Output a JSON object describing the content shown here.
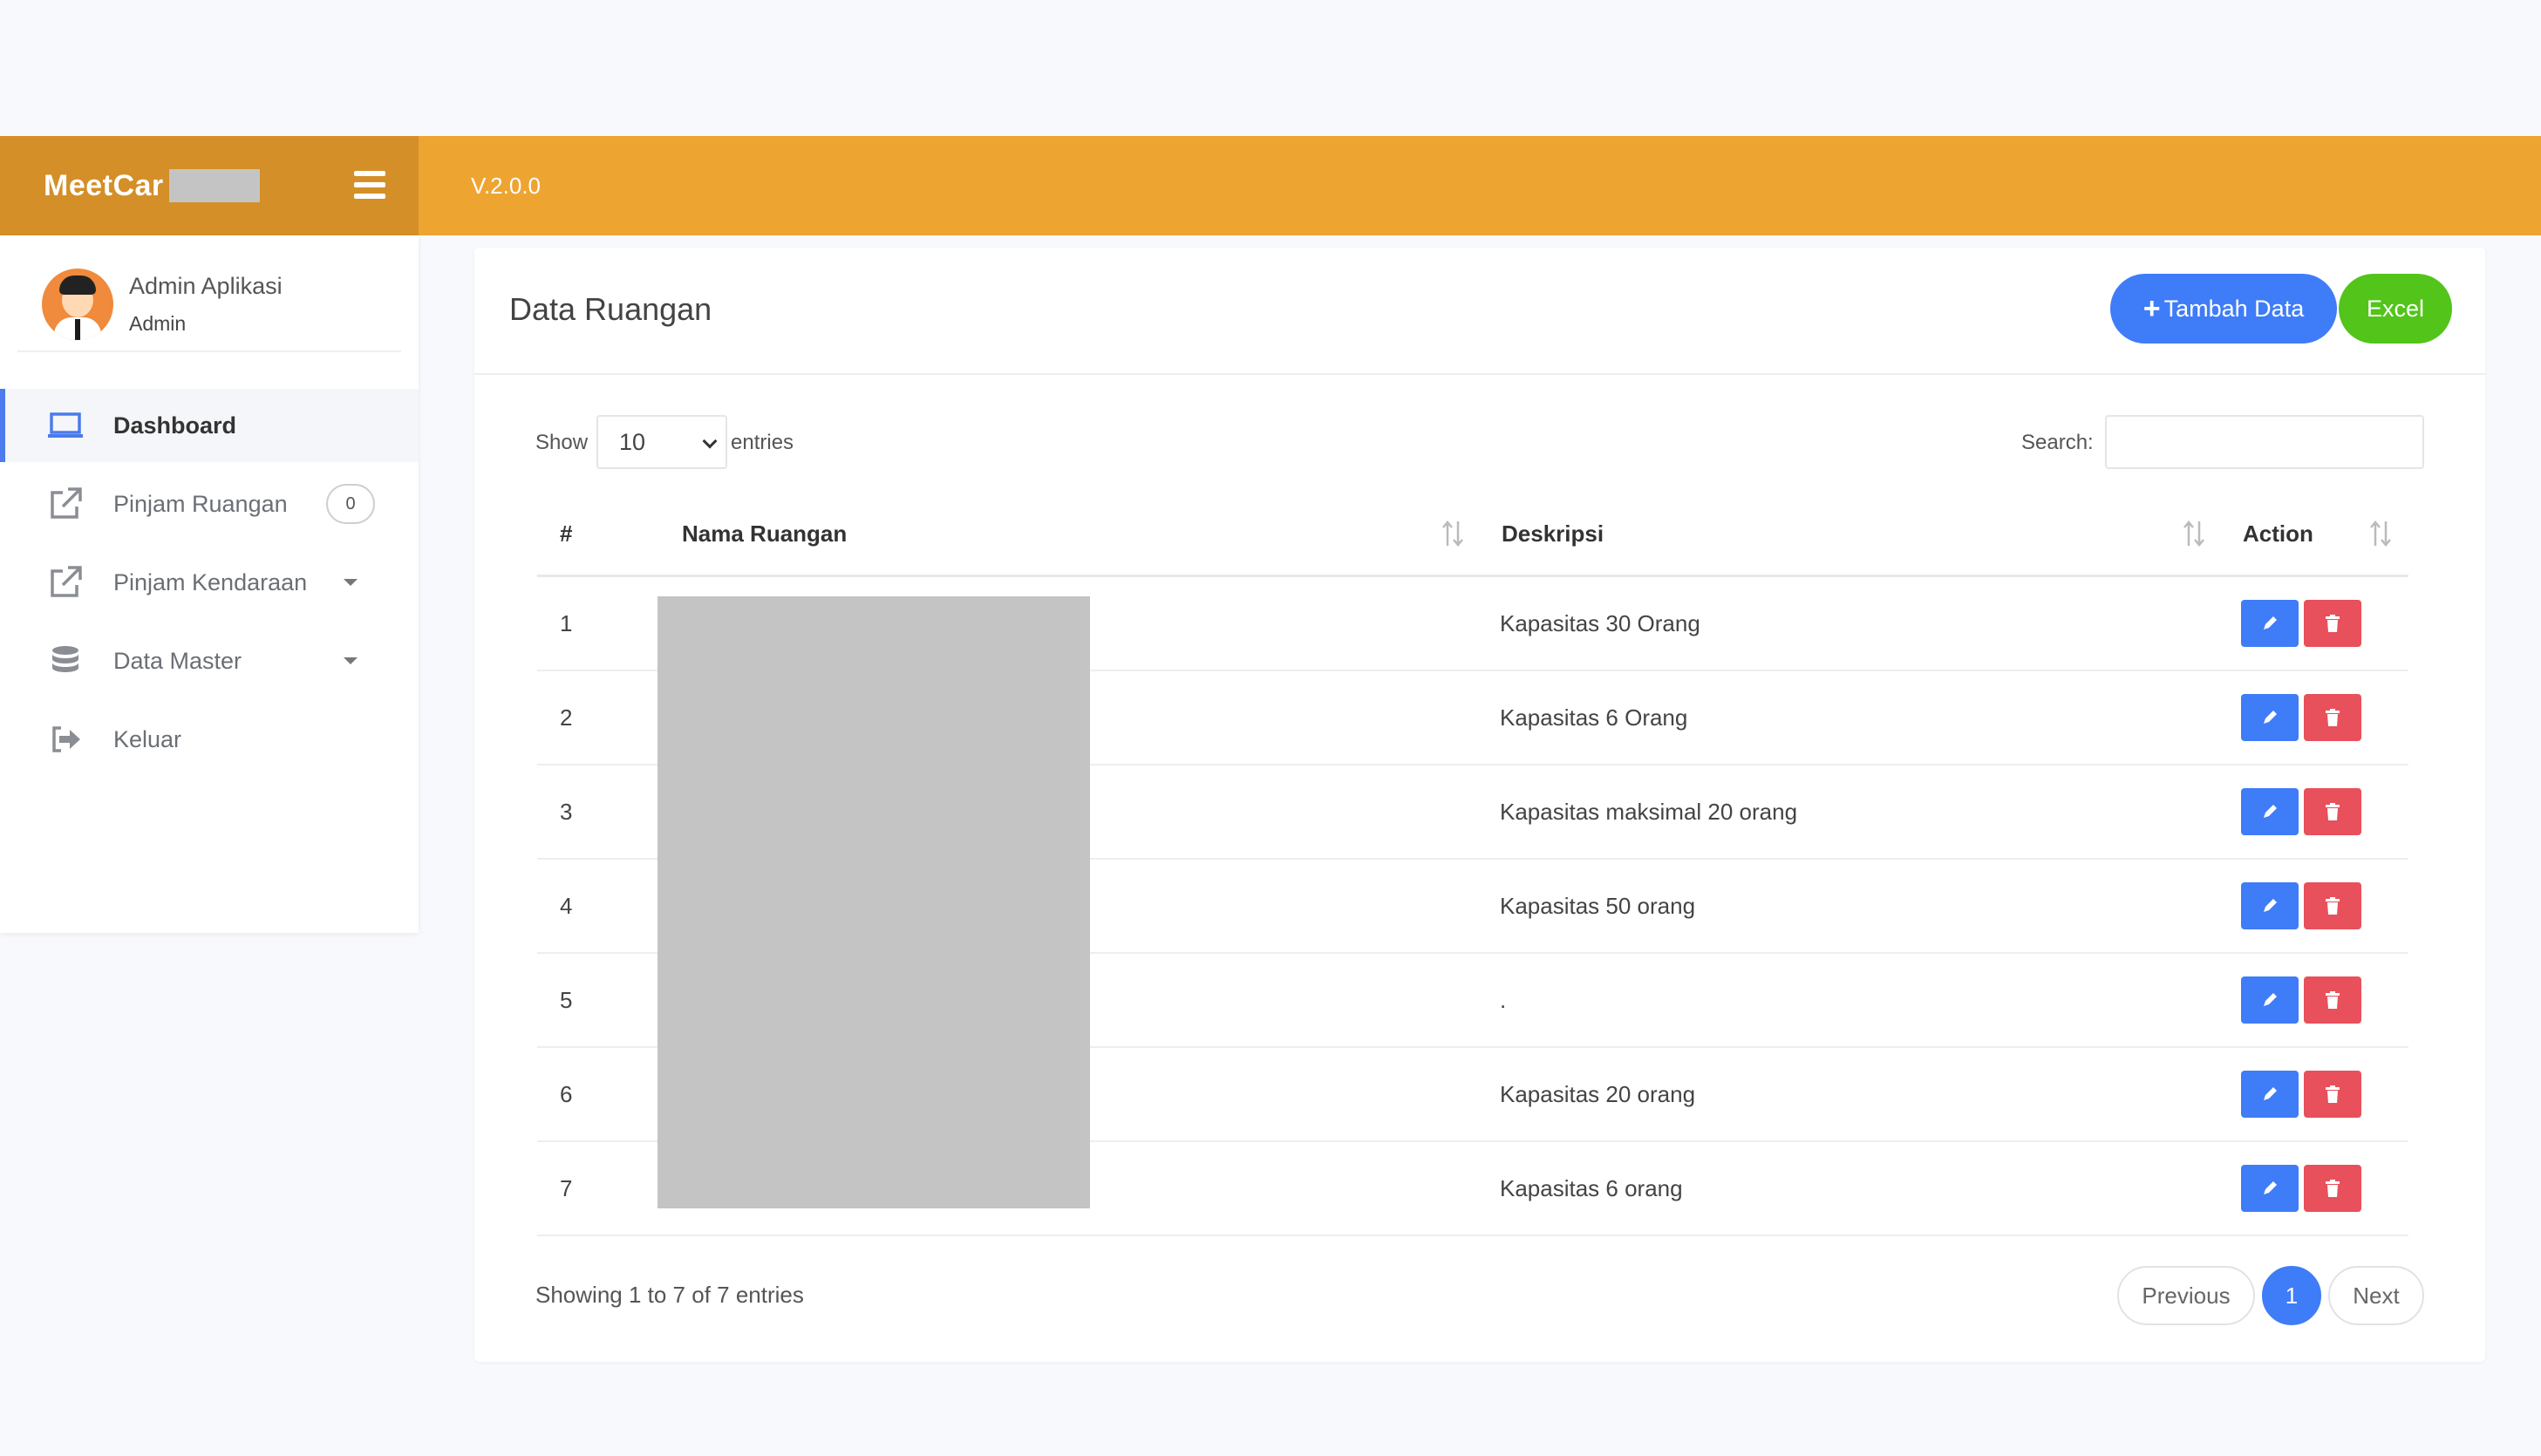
{
  "header": {
    "brand": "MeetCar",
    "version": "V.2.0.0"
  },
  "user": {
    "name": "Admin Aplikasi",
    "role": "Admin"
  },
  "sidebar": {
    "items": [
      {
        "label": "Dashboard",
        "icon": "laptop-icon"
      },
      {
        "label": "Pinjam Ruangan",
        "icon": "external-link-icon",
        "badge": "0"
      },
      {
        "label": "Pinjam Kendaraan",
        "icon": "external-link-icon"
      },
      {
        "label": "Data Master",
        "icon": "database-icon"
      },
      {
        "label": "Keluar",
        "icon": "sign-out-icon"
      }
    ]
  },
  "card": {
    "title": "Data Ruangan",
    "add_label": "Tambah Data",
    "excel_label": "Excel"
  },
  "controls": {
    "show_label": "Show",
    "page_size": "10",
    "entries_label": "entries",
    "search_label": "Search:"
  },
  "table": {
    "headers": [
      "#",
      "Nama Ruangan",
      "Deskripsi",
      "Action"
    ],
    "rows": [
      {
        "no": "1",
        "desc": "Kapasitas 30 Orang"
      },
      {
        "no": "2",
        "desc": "Kapasitas 6 Orang"
      },
      {
        "no": "3",
        "desc": "Kapasitas maksimal 20 orang"
      },
      {
        "no": "4",
        "desc": "Kapasitas 50 orang"
      },
      {
        "no": "5",
        "desc": "."
      },
      {
        "no": "6",
        "desc": "Kapasitas 20 orang"
      },
      {
        "no": "7",
        "desc": "Kapasitas 6 orang"
      }
    ]
  },
  "footer": {
    "info": "Showing 1 to 7 of 7 entries",
    "prev": "Previous",
    "current": "1",
    "next": "Next"
  },
  "colors": {
    "topbar": "#eea431",
    "brand_bg": "#d48f28",
    "primary": "#3f7cf7",
    "success": "#52c41a",
    "danger": "#e8505b"
  }
}
